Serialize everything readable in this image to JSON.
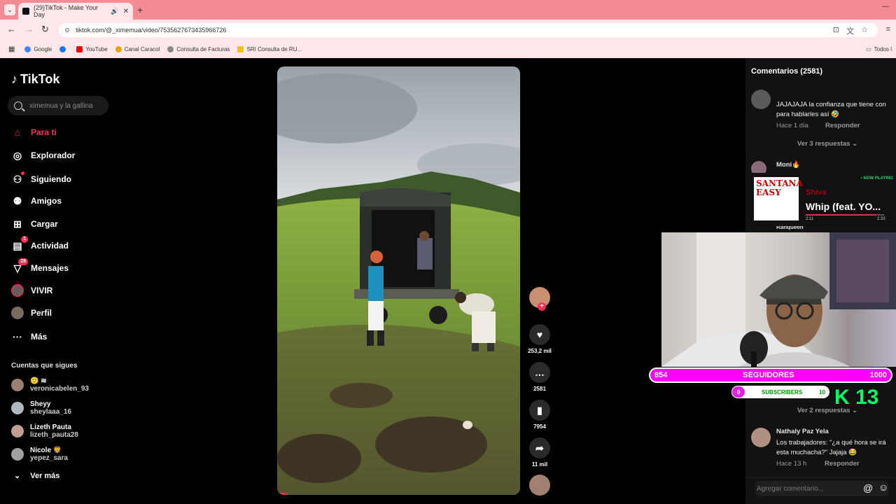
{
  "browser": {
    "tab_title": "(29)TikTok - Make Your Day",
    "new_tab": "+",
    "url": "tiktok.com/@_ximemua/video/7535627673435966726",
    "bookmarks": [
      "Google",
      "YouTube",
      "Canal Caracol",
      "Consulta de Facturas",
      "SRI Consulta de RU..."
    ],
    "bookmarks_all": "Todos l"
  },
  "sidebar": {
    "logo": "TikTok",
    "search_placeholder": "ximemua y la gallina",
    "nav": [
      {
        "label": "Para ti",
        "icon": "home-icon",
        "active": true
      },
      {
        "label": "Explorador",
        "icon": "compass-icon"
      },
      {
        "label": "Siguiendo",
        "icon": "following-icon"
      },
      {
        "label": "Amigos",
        "icon": "friends-icon"
      },
      {
        "label": "Cargar",
        "icon": "upload-icon"
      },
      {
        "label": "Actividad",
        "icon": "activity-icon",
        "badge": "1"
      },
      {
        "label": "Mensajes",
        "icon": "messages-icon",
        "badge": "28"
      },
      {
        "label": "VIVIR",
        "icon": "live-icon"
      },
      {
        "label": "Perfil",
        "icon": "profile-icon"
      },
      {
        "label": "Más",
        "icon": "more-icon"
      }
    ],
    "following_header": "Cuentas que sigues",
    "accounts": [
      {
        "name": "🙂 ≋",
        "handle": "veronicabelen_93"
      },
      {
        "name": "Sheyy",
        "handle": "sheylaaa_16"
      },
      {
        "name": "Lizeth Pauta",
        "handle": "lizeth_pauta28"
      },
      {
        "name": "Nicole 🦁",
        "handle": "yepez_sara"
      }
    ],
    "see_more": "Ver más"
  },
  "actions": {
    "likes": "253,2 mil",
    "comments": "2581",
    "saves": "7954",
    "shares": "11 mil"
  },
  "comments_panel": {
    "title": "Comentarios (2581)",
    "c1": {
      "text": "JAJAJAJA la confianza que tiene con para hablarles así 🤣",
      "time": "Hace 1 día",
      "reply": "Responder",
      "replies": "Ver 3 respuestas"
    },
    "c2_user": "Moni🔥",
    "c3_user": "Ranqueen",
    "c3_replies": "Ver 2 respuestas",
    "c4": {
      "user": "Nathaly Paz Yela",
      "text": "Los trabajadores: \"¿a qué hora se irá esta muchacha?\" Jajaja 😂",
      "time": "Hace 13 h",
      "reply": "Responder"
    },
    "add_placeholder": "Agregar comentario..."
  },
  "now_playing": {
    "label": "• NOW PLAYING",
    "art_text": "SANTANA EASY",
    "artist": "Shiva",
    "song": "Whip (feat. YO...",
    "elapsed": "2:11",
    "total": "2:33",
    "progress": 0.9
  },
  "stream_overlay": {
    "followers_current": "854",
    "followers_label": "SEGUIDORES",
    "followers_goal": "1000",
    "subs_current": "0",
    "subs_label": "SUBSCRIBERS",
    "subs_goal": "10",
    "k13": "K 13"
  }
}
